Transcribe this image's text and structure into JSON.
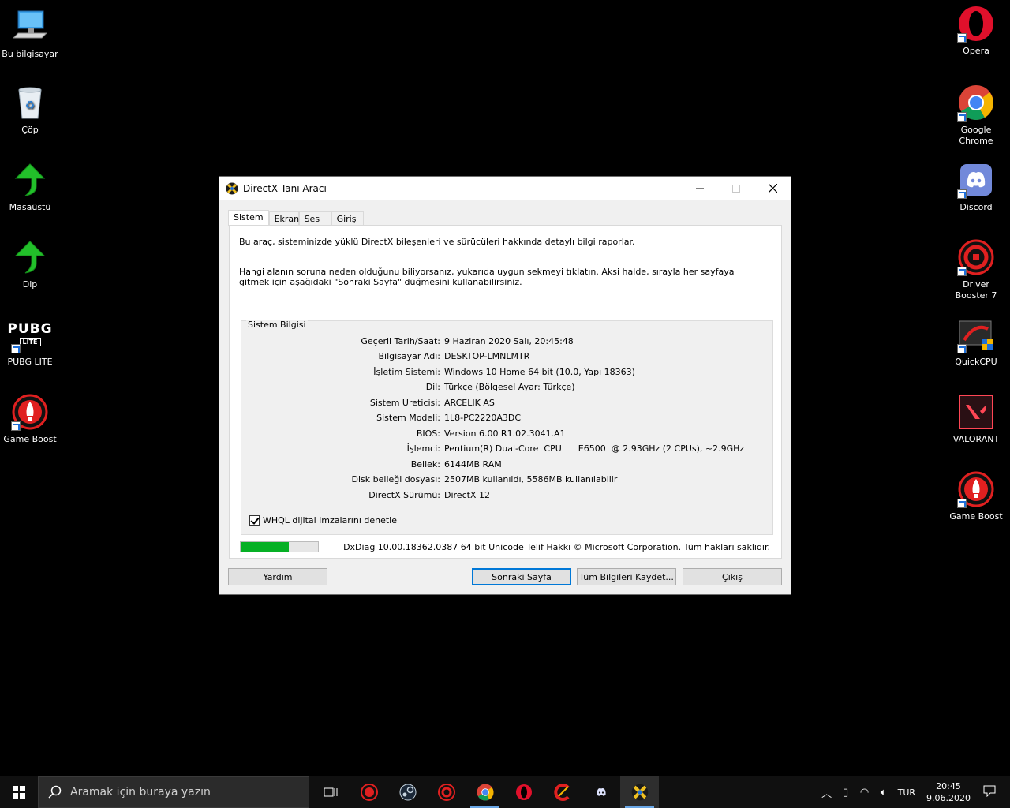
{
  "desktop": {
    "left_icons": [
      {
        "label": "Bu bilgisayar"
      },
      {
        "label": "Çöp"
      },
      {
        "label": "Masaüstü"
      },
      {
        "label": "Dip"
      },
      {
        "label": "PUBG LITE"
      },
      {
        "label": "Game Boost"
      }
    ],
    "right_icons": [
      {
        "label": "Opera"
      },
      {
        "label": "Google Chrome"
      },
      {
        "label": "Discord"
      },
      {
        "label": "Driver Booster 7"
      },
      {
        "label": "QuickCPU"
      },
      {
        "label": "VALORANT"
      },
      {
        "label": "Game Boost"
      }
    ],
    "pubg_logo_text": "PUBG",
    "pubg_logo_sub": "LITE"
  },
  "window": {
    "title": "DirectX Tanı Aracı",
    "tabs": [
      "Sistem",
      "Ekran",
      "Ses",
      "Giriş"
    ],
    "intro1": "Bu araç, sisteminizde yüklü DirectX bileşenleri ve sürücüleri hakkında detaylı bilgi raporlar.",
    "intro2": "Hangi alanın soruna neden olduğunu biliyorsanız, yukarıda uygun sekmeyi tıklatın. Aksi halde, sırayla her sayfaya gitmek için aşağıdaki \"Sonraki Sayfa\" düğmesini kullanabilirsiniz.",
    "group_title": "Sistem Bilgisi",
    "info": [
      {
        "label": "Geçerli Tarih/Saat:",
        "value": "9 Haziran 2020 Salı, 20:45:48"
      },
      {
        "label": "Bilgisayar Adı:",
        "value": "DESKTOP-LMNLMTR"
      },
      {
        "label": "İşletim Sistemi:",
        "value": "Windows 10 Home 64 bit (10.0, Yapı 18363)"
      },
      {
        "label": "Dil:",
        "value": "Türkçe (Bölgesel Ayar: Türkçe)"
      },
      {
        "label": "Sistem Üreticisi:",
        "value": "ARCELIK AS"
      },
      {
        "label": "Sistem Modeli:",
        "value": "1L8-PC2220A3DC"
      },
      {
        "label": "BIOS:",
        "value": "Version 6.00 R1.02.3041.A1"
      },
      {
        "label": "İşlemci:",
        "value": "Pentium(R) Dual-Core  CPU      E6500  @ 2.93GHz (2 CPUs), ~2.9GHz"
      },
      {
        "label": "Bellek:",
        "value": "6144MB RAM"
      },
      {
        "label": "Disk belleği dosyası:",
        "value": "2507MB kullanıldı, 5586MB kullanılabilir"
      },
      {
        "label": "DirectX Sürümü:",
        "value": "DirectX 12"
      }
    ],
    "checkbox_label": "WHQL dijital imzalarını denetle",
    "progress": 0.62,
    "footer": "DxDiag 10.00.18362.0387 64 bit Unicode  Telif Hakkı © Microsoft Corporation. Tüm hakları saklıdır.",
    "buttons": {
      "help": "Yardım",
      "next": "Sonraki Sayfa",
      "save": "Tüm Bilgileri Kaydet...",
      "exit": "Çıkış"
    }
  },
  "taskbar": {
    "search_placeholder": "Aramak için buraya yazın",
    "lang": "TUR",
    "time": "20:45",
    "date": "9.06.2020"
  },
  "colors": {
    "progress_fill": "#06b025",
    "accent": "#0078d7"
  }
}
